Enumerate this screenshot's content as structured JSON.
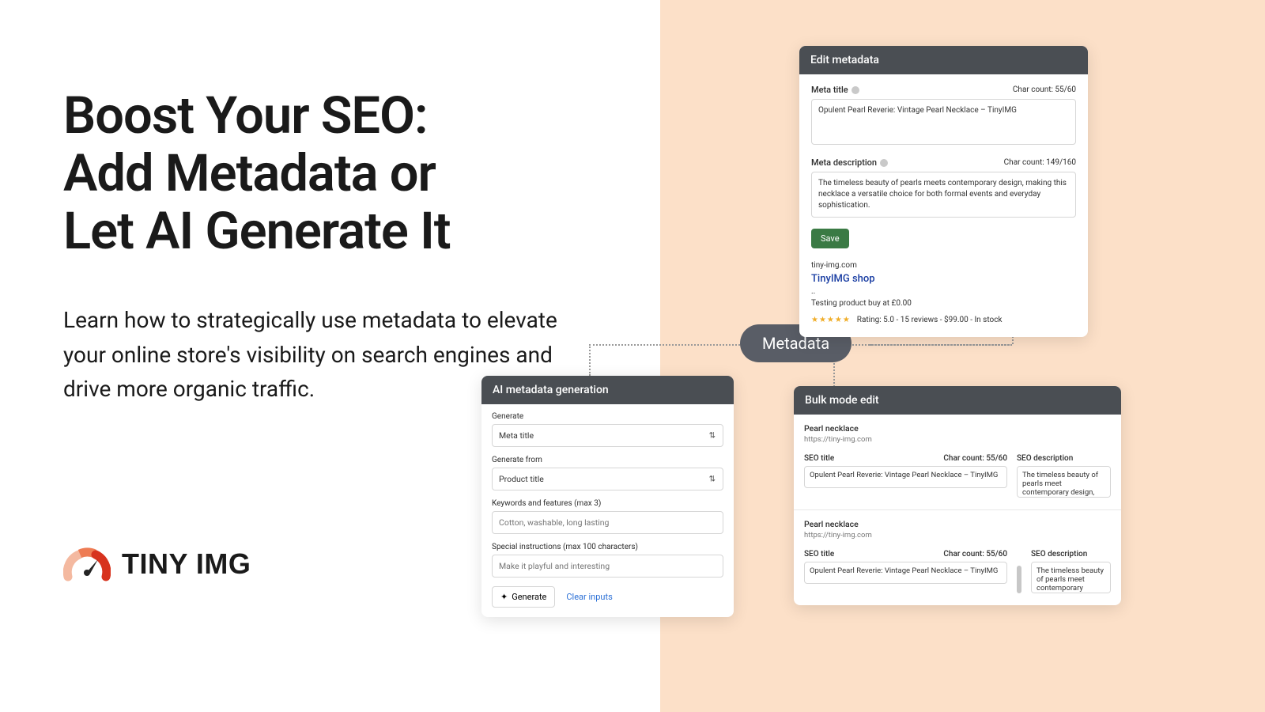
{
  "hero": {
    "line1": "Boost Your SEO:",
    "line2": "Add Metadata or",
    "line3": "Let AI Generate It",
    "subtext": "Learn how to strategically use metadata to elevate your online store's visibility on search engines and drive more organic traffic."
  },
  "logo": {
    "text": "TINY IMG"
  },
  "pill": {
    "label": "Metadata"
  },
  "edit": {
    "title": "Edit metadata",
    "meta_title_label": "Meta title",
    "meta_title_count": "Char count: 55/60",
    "meta_title_value": "Opulent Pearl Reverie: Vintage Pearl Necklace – TinyIMG",
    "meta_desc_label": "Meta description",
    "meta_desc_count": "Char count: 149/160",
    "meta_desc_value": "The timeless beauty of pearls meets contemporary design, making this necklace a versatile choice for both formal events and everyday sophistication.",
    "save": "Save",
    "preview_url": "tiny-img.com",
    "preview_title": "TinyIMG shop",
    "preview_dots": "..",
    "preview_line": "Testing product buy at £0.00",
    "stars": "★★★★★",
    "rating_text": "Rating: 5.0 - 15 reviews - $99.00 - In stock"
  },
  "ai": {
    "title": "AI metadata generation",
    "generate_label": "Generate",
    "generate_value": "Meta title",
    "from_label": "Generate from",
    "from_value": "Product title",
    "keywords_label": "Keywords and features (max 3)",
    "keywords_placeholder": "Cotton, washable, long lasting",
    "instructions_label": "Special instructions (max 100 characters)",
    "instructions_placeholder": "Make it playful and interesting",
    "generate_btn": "Generate",
    "clear_btn": "Clear inputs"
  },
  "bulk": {
    "title": "Bulk mode edit",
    "product_name": "Pearl necklace",
    "product_url": "https://tiny-img.com",
    "seo_title_label": "SEO title",
    "char_count": "Char count: 55/60",
    "seo_desc_label": "SEO description",
    "seo_title_value": "Opulent Pearl Reverie: Vintage Pearl Necklace – TinyIMG",
    "seo_desc_value": "The timeless beauty of pearls meet contemporary design, making this"
  }
}
